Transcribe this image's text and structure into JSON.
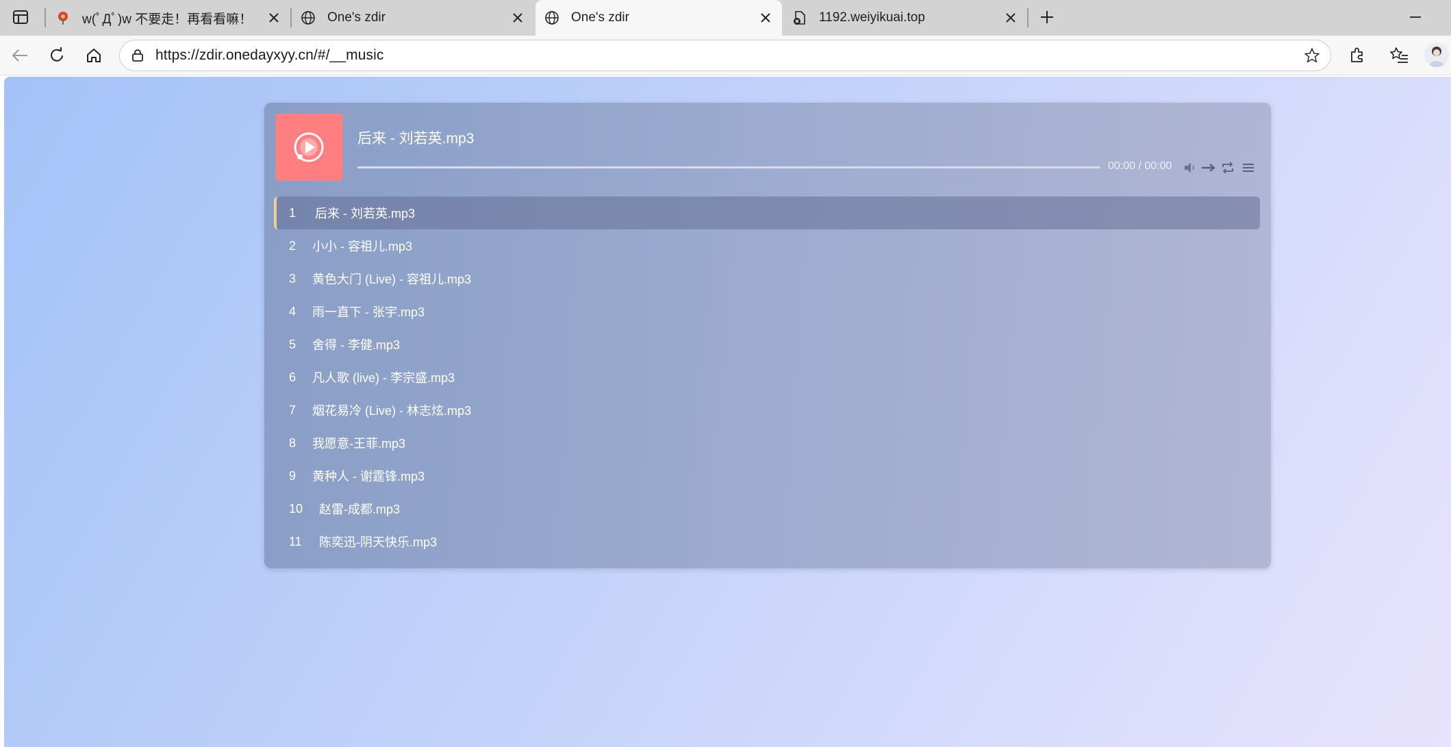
{
  "browser": {
    "tabs": [
      {
        "title": "w(ﾟДﾟ)w 不要走！再看看嘛！",
        "active": false
      },
      {
        "title": "One's zdir",
        "active": false
      },
      {
        "title": "One's zdir",
        "active": true
      },
      {
        "title": "1192.weiyikuai.top",
        "active": false
      }
    ],
    "url": "https://zdir.onedayxyy.cn/#/__music"
  },
  "player": {
    "now_playing": "后来 - 刘若英.mp3",
    "time": "00:00 / 00:00",
    "progress": 0,
    "cover_color": "#ff7f80",
    "accent_color": "#f3cf8c"
  },
  "playlist": [
    {
      "num": "1",
      "title": "后来 - 刘若英.mp3"
    },
    {
      "num": "2",
      "title": "小小 - 容祖儿.mp3"
    },
    {
      "num": "3",
      "title": "黄色大门 (Live) - 容祖儿.mp3"
    },
    {
      "num": "4",
      "title": "雨一直下 - 张宇.mp3"
    },
    {
      "num": "5",
      "title": "舍得 - 李健.mp3"
    },
    {
      "num": "6",
      "title": "凡人歌 (live) - 李宗盛.mp3"
    },
    {
      "num": "7",
      "title": "烟花易冷 (Live) - 林志炫.mp3"
    },
    {
      "num": "8",
      "title": "我愿意-王菲.mp3"
    },
    {
      "num": "9",
      "title": "黄种人 - 谢霆锋.mp3"
    },
    {
      "num": "10",
      "title": "赵雷-成都.mp3"
    },
    {
      "num": "11",
      "title": "陈奕迅-阴天快乐.mp3"
    }
  ]
}
